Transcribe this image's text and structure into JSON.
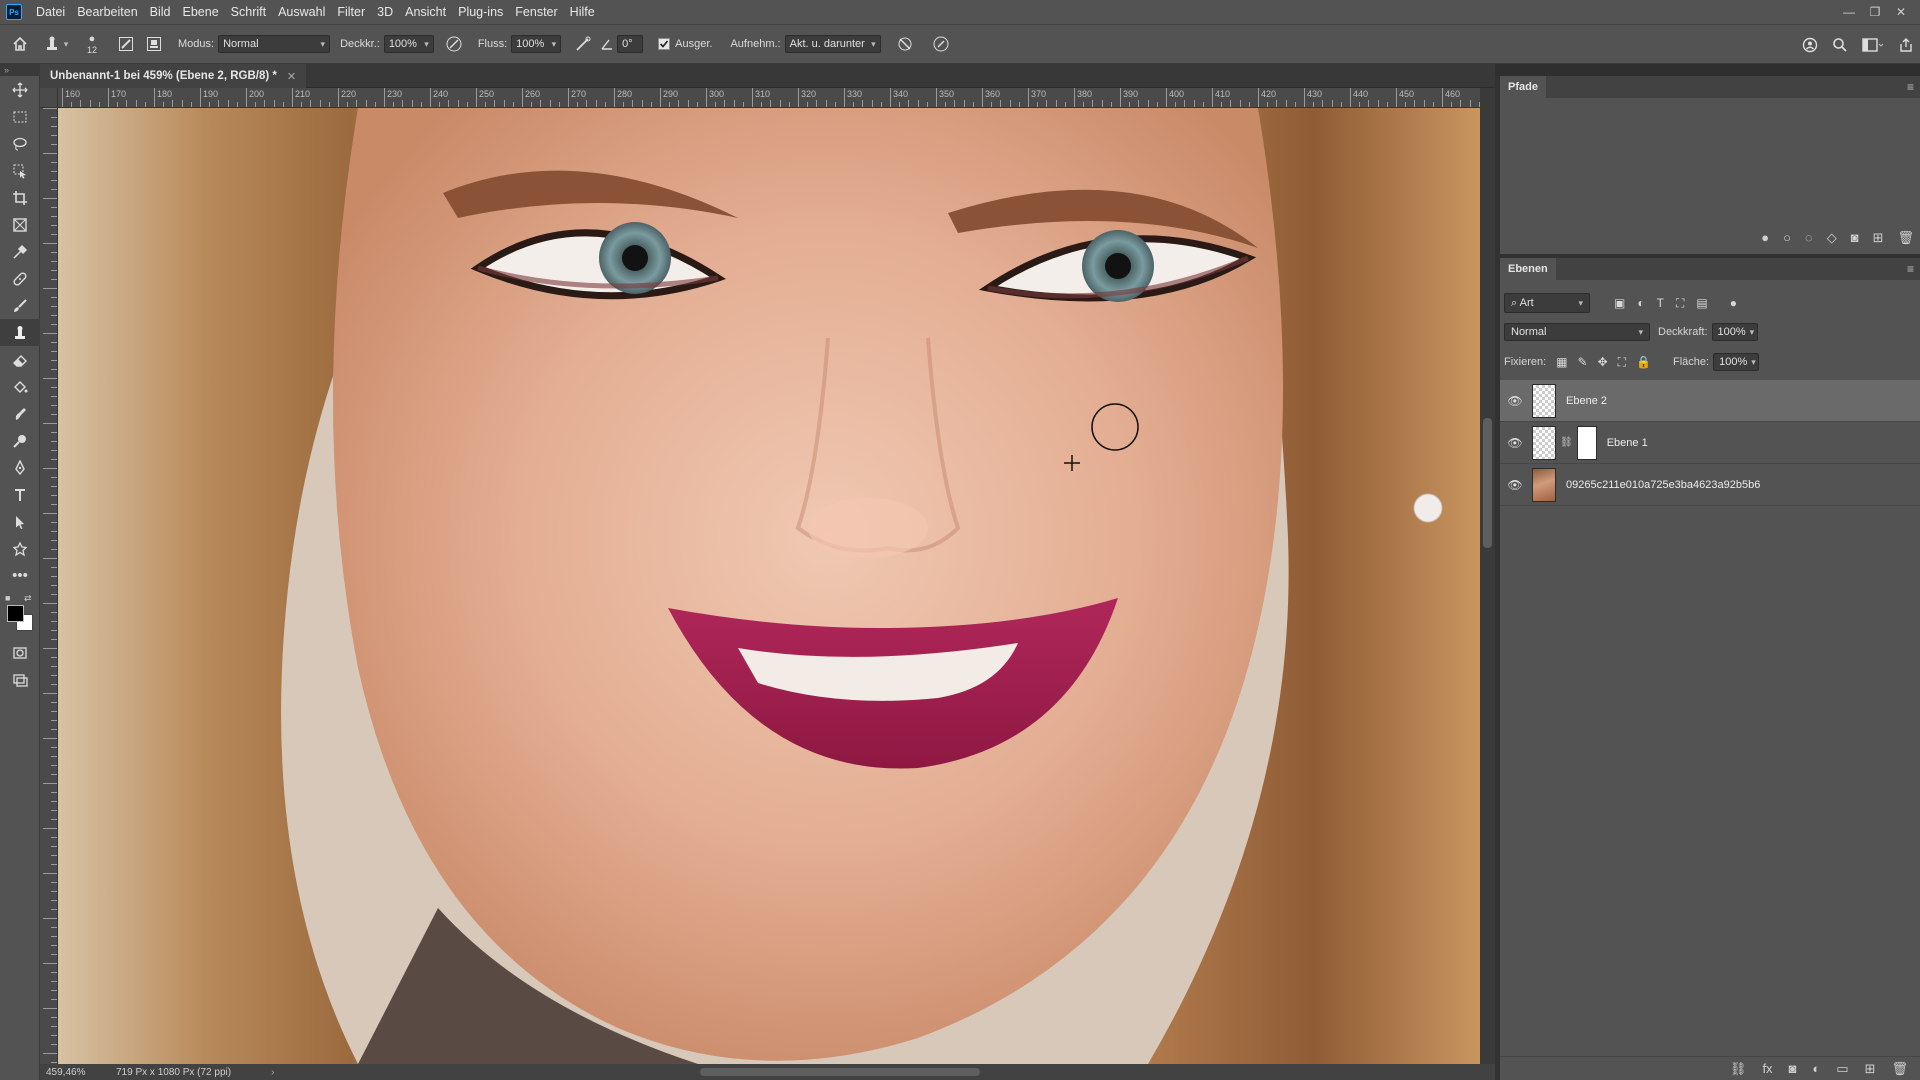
{
  "app": {
    "logo": "Ps"
  },
  "menu": [
    "Datei",
    "Bearbeiten",
    "Bild",
    "Ebene",
    "Schrift",
    "Auswahl",
    "Filter",
    "3D",
    "Ansicht",
    "Plug-ins",
    "Fenster",
    "Hilfe"
  ],
  "window_controls": {
    "minimize": "—",
    "restore": "❐",
    "close": "✕"
  },
  "options_bar": {
    "brush_size": "12",
    "modus_label": "Modus:",
    "modus_value": "Normal",
    "deckkraft_label": "Deckkr.:",
    "deckkraft_value": "100%",
    "fluss_label": "Fluss:",
    "fluss_value": "100%",
    "angle_value": "0°",
    "ausger_label": "Ausger.",
    "ausger_checked": true,
    "aufnehm_label": "Aufnehm.:",
    "aufnehm_value": "Akt. u. darunter"
  },
  "document": {
    "tab_title": "Unbenannt-1 bei 459% (Ebene 2, RGB/8) *",
    "zoom": "459,46%",
    "size": "719 Px x 1080 Px (72 ppi)"
  },
  "ruler_labels": [
    "160",
    "170",
    "180",
    "190",
    "200",
    "210",
    "220",
    "230",
    "240",
    "250",
    "260",
    "270",
    "280",
    "290",
    "300",
    "310",
    "320",
    "330",
    "340",
    "350",
    "360",
    "370",
    "380",
    "390",
    "400",
    "410",
    "420",
    "430",
    "440",
    "450",
    "460"
  ],
  "paths_panel": {
    "tab": "Pfade"
  },
  "layers_panel": {
    "tab": "Ebenen",
    "filter_value": "Art",
    "blend_mode": "Normal",
    "deckkraft_label": "Deckkraft:",
    "deckkraft_value": "100%",
    "fixieren_label": "Fixieren:",
    "flaeche_label": "Fläche:",
    "flaeche_value": "100%",
    "layers": [
      {
        "name": "Ebene 2",
        "visible": true,
        "selected": true,
        "kind": "empty"
      },
      {
        "name": "Ebene 1",
        "visible": true,
        "selected": false,
        "kind": "masked"
      },
      {
        "name": "09265c211e010a725e3ba4623a92b5b6",
        "visible": true,
        "selected": false,
        "kind": "photo"
      }
    ]
  },
  "colors": {
    "accent": "#31a8ff",
    "lips": "#a3204f",
    "iris": "#7a9ba0",
    "skin": "#e8b9a0",
    "hair": "#b58457"
  },
  "icons": {
    "home": "home-icon",
    "stamp": "clone-stamp-icon",
    "eye": "eye-icon",
    "search": "search-icon",
    "share": "share-icon"
  }
}
